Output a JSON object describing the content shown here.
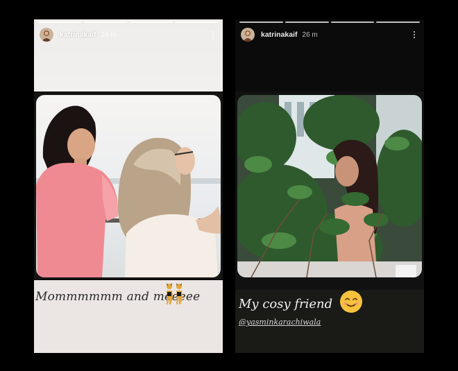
{
  "stories": [
    {
      "username": "katrinakaif",
      "time": "24 m",
      "progress_segments": 4,
      "caption": "Mommmmmm and meeeee",
      "sticker": "dancing-figures-emoji"
    },
    {
      "username": "katrinakaif",
      "time": "26 m",
      "progress_segments": 4,
      "caption": "My cosy friend",
      "sticker": "smiling-face-emoji",
      "mention": "@yasminkarachiwala"
    }
  ],
  "colors": {
    "left_caption_bg": "#ebe5e4",
    "right_caption_bg": "#1a1a17",
    "left_top_bg": "#efedec",
    "right_top_bg": "#0b0b0b"
  },
  "icons": [
    "avatar",
    "more-vertical-icon"
  ]
}
